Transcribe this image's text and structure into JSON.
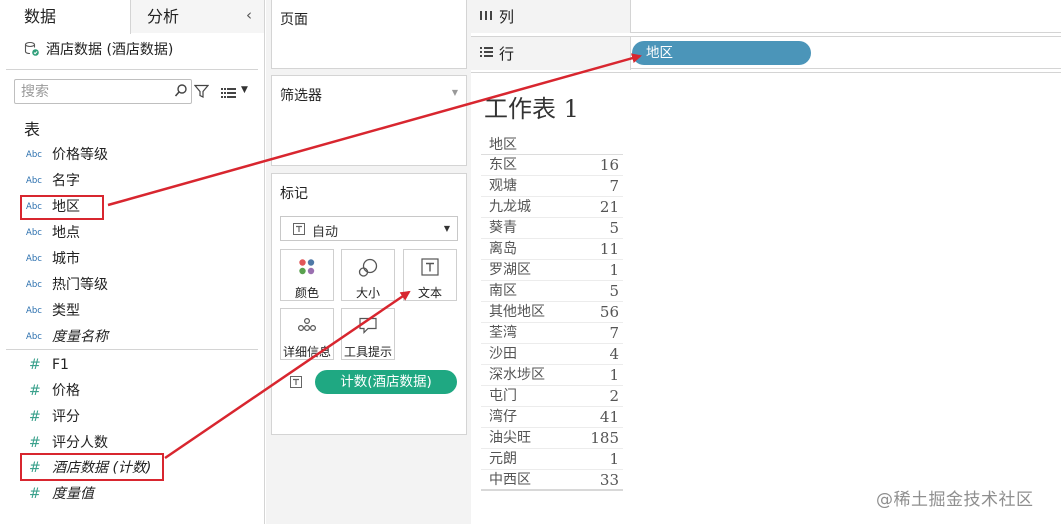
{
  "data_pane": {
    "tab_data": "数据",
    "tab_analysis": "分析",
    "datasource_label": "酒店数据 (酒店数据)",
    "search_placeholder": "搜索",
    "tables_title": "表",
    "dimensions": [
      {
        "label": "价格等级",
        "type": "Abc",
        "italic": false
      },
      {
        "label": "名字",
        "type": "Abc",
        "italic": false
      },
      {
        "label": "地区",
        "type": "Abc",
        "italic": false,
        "highlighted": true
      },
      {
        "label": "地点",
        "type": "Abc",
        "italic": false
      },
      {
        "label": "城市",
        "type": "Abc",
        "italic": false
      },
      {
        "label": "热门等级",
        "type": "Abc",
        "italic": false
      },
      {
        "label": "类型",
        "type": "Abc",
        "italic": false
      },
      {
        "label": "度量名称",
        "type": "Abc",
        "italic": true
      }
    ],
    "measures": [
      {
        "label": "F1",
        "type": "#",
        "italic": false
      },
      {
        "label": "价格",
        "type": "#",
        "italic": false
      },
      {
        "label": "评分",
        "type": "#",
        "italic": false
      },
      {
        "label": "评分人数",
        "type": "#",
        "italic": false
      },
      {
        "label": "酒店数据 (计数)",
        "type": "#",
        "italic": true,
        "highlighted": true
      },
      {
        "label": "度量值",
        "type": "#",
        "italic": true
      }
    ]
  },
  "cards": {
    "pages_title": "页面",
    "filters_title": "筛选器",
    "marks_title": "标记",
    "mark_type": "自动",
    "mark_buttons": {
      "color": "颜色",
      "size": "大小",
      "text": "文本",
      "detail": "详细信息",
      "tooltip": "工具提示"
    },
    "text_field_pill": "计数(酒店数据)"
  },
  "shelves": {
    "columns_label": "列",
    "rows_label": "行",
    "rows_pill": "地区"
  },
  "view": {
    "sheet_title": "工作表 1",
    "column_header": "地区",
    "rows": [
      {
        "name": "东区",
        "value": "16"
      },
      {
        "name": "观塘",
        "value": "7"
      },
      {
        "name": "九龙城",
        "value": "21"
      },
      {
        "name": "葵青",
        "value": "5"
      },
      {
        "name": "离岛",
        "value": "11"
      },
      {
        "name": "罗湖区",
        "value": "1"
      },
      {
        "name": "南区",
        "value": "5"
      },
      {
        "name": "其他地区",
        "value": "56"
      },
      {
        "name": "荃湾",
        "value": "7"
      },
      {
        "name": "沙田",
        "value": "4"
      },
      {
        "name": "深水埗区",
        "value": "1"
      },
      {
        "name": "屯门",
        "value": "2"
      },
      {
        "name": "湾仔",
        "value": "41"
      },
      {
        "name": "油尖旺",
        "value": "185"
      },
      {
        "name": "元朗",
        "value": "1"
      },
      {
        "name": "中西区",
        "value": "33"
      }
    ]
  },
  "watermark": "@稀土掘金技术社区",
  "colors": {
    "rows_pill": "#4b95b9",
    "measure_pill": "#1fa882",
    "annotation_red": "#d8262f",
    "dimension_icon": "#2a6fae",
    "measure_icon": "#3aa18c"
  }
}
